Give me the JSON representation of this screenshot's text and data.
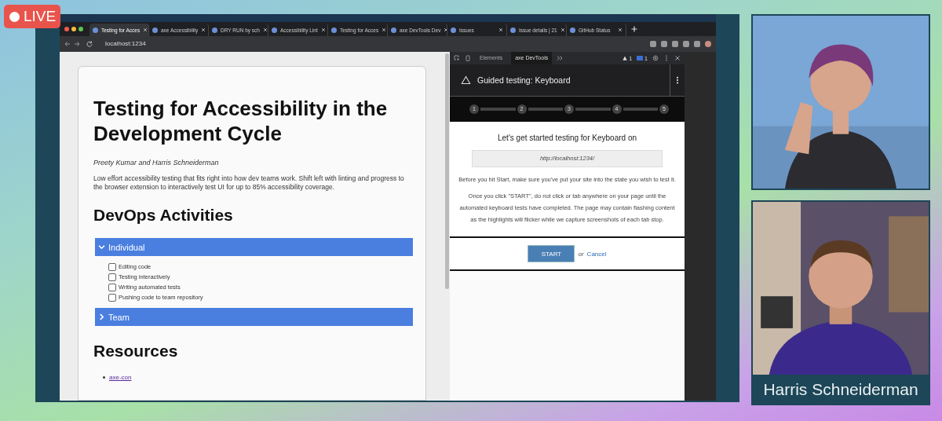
{
  "live_badge": {
    "label": "LIVE"
  },
  "browser": {
    "tabs": [
      {
        "title": "Testing for Acces",
        "selected": true
      },
      {
        "title": "axe Accessibility",
        "selected": false
      },
      {
        "title": "DRY RUN by sch",
        "selected": false
      },
      {
        "title": "Accessibility Lint",
        "selected": false
      },
      {
        "title": "Testing for Acces",
        "selected": false
      },
      {
        "title": "axe DevTools Dev",
        "selected": false
      },
      {
        "title": "Issues",
        "selected": false
      },
      {
        "title": "Issue details | 21",
        "selected": false
      },
      {
        "title": "GitHub Status",
        "selected": false
      }
    ],
    "address": "localhost:1234"
  },
  "page": {
    "title": "Testing for Accessibility in the Development Cycle",
    "authors": "Preety Kumar and Harris Schneiderman",
    "intro": "Low effort accessibility testing that fits right into how dev teams work. Shift left with linting and progress to the browser extension to interactively test UI for up to 85% accessibility coverage.",
    "section_heading": "DevOps Activities",
    "accordions": [
      {
        "label": "Individual",
        "expanded": true,
        "items": [
          {
            "label": "Editing code",
            "checked": false
          },
          {
            "label": "Testing interactively",
            "checked": false
          },
          {
            "label": "Writing automated tests",
            "checked": false
          },
          {
            "label": "Pushing code to team repository",
            "checked": false
          }
        ]
      },
      {
        "label": "Team",
        "expanded": false
      }
    ],
    "resources_heading": "Resources",
    "links": [
      "axe-con"
    ]
  },
  "devtools": {
    "tabs": [
      {
        "label": "Elements",
        "selected": false
      },
      {
        "label": "axe DevTools",
        "selected": true
      }
    ],
    "warnings": "1",
    "messages": "1",
    "panel_title": "Guided testing: Keyboard",
    "steps": [
      "1",
      "2",
      "3",
      "4",
      "5"
    ],
    "heading": "Let's get started testing for Keyboard on",
    "url": "http://localhost:1234/",
    "note": "Before you hit Start, make sure you've put your site into the state you wish to test it.",
    "instructions": "Once you click \"START\", do not click or tab anywhere on your page until the automated keyboard tests have completed. The page may contain flashing content as the highlights will flicker while we capture screenshots of each tab stop.",
    "start": "START",
    "or": "or",
    "cancel": "Cancel"
  },
  "participants": [
    {
      "kind": "picture"
    },
    {
      "kind": "picture",
      "name": "Harris Schneiderman"
    }
  ]
}
